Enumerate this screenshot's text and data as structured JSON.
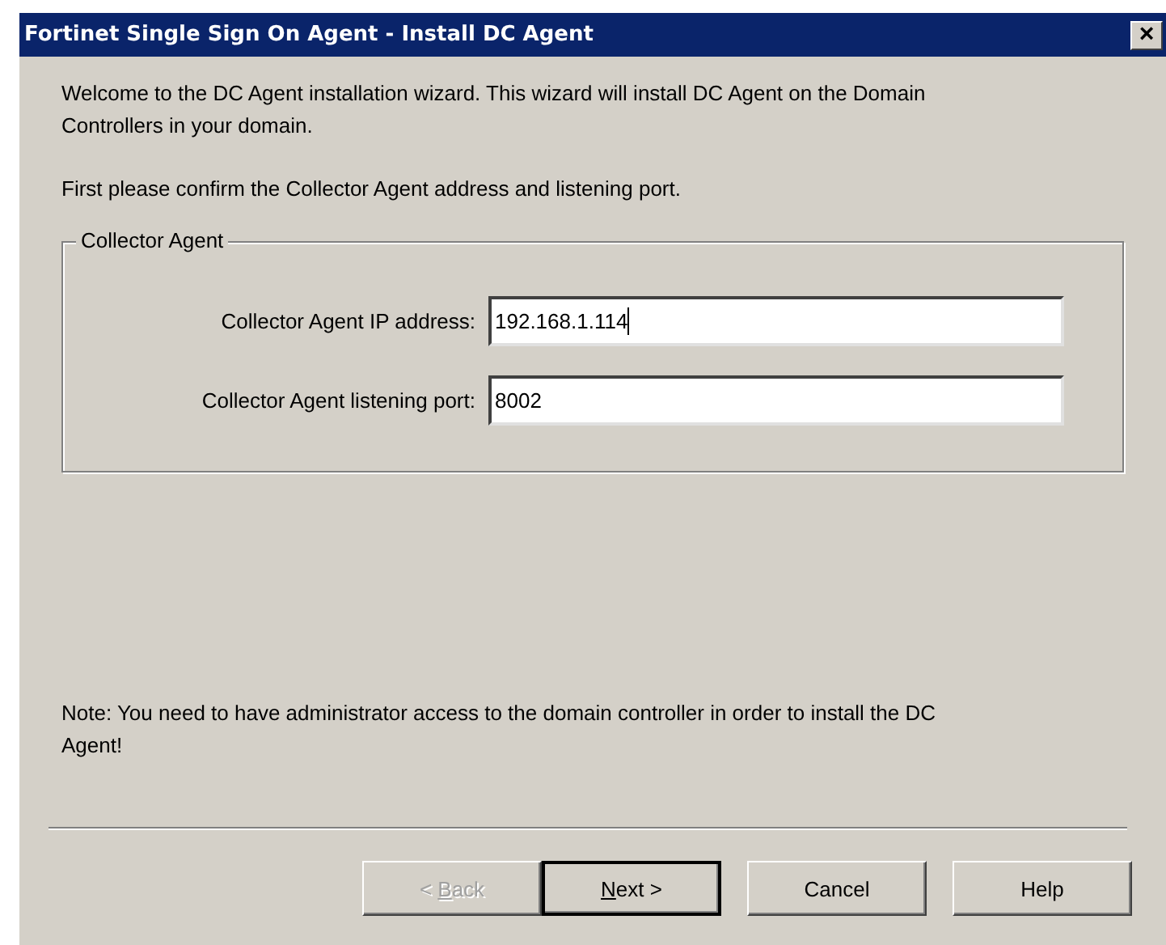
{
  "window": {
    "title": "Fortinet Single Sign On Agent - Install DC Agent",
    "close": "×"
  },
  "intro": "Welcome to the DC Agent installation wizard. This wizard will install DC Agent on the Domain Controllers in your domain.",
  "instruction": "First please confirm the Collector Agent address and listening port.",
  "group": {
    "title": "Collector Agent",
    "fields": [
      {
        "label": "Collector Agent IP address:",
        "value": "192.168.1.114",
        "focused": true
      },
      {
        "label": "Collector Agent listening port:",
        "value": "8002",
        "focused": false
      }
    ]
  },
  "note": "Note: You need to have administrator access to the domain controller in order to install the DC Agent!",
  "buttons": [
    {
      "label_parts": [
        {
          "text": "< ",
          "underlined": false
        },
        {
          "text": "B",
          "underlined": true
        },
        {
          "text": "ack",
          "underlined": false
        }
      ],
      "disabled": true,
      "default": false
    },
    {
      "label_parts": [
        {
          "text": "N",
          "underlined": true
        },
        {
          "text": "ext >",
          "underlined": false
        }
      ],
      "disabled": false,
      "default": true
    },
    {
      "label_parts": [
        {
          "text": "Cancel",
          "underlined": false
        }
      ],
      "disabled": false,
      "default": false
    },
    {
      "label_parts": [
        {
          "text": "Help",
          "underlined": false
        }
      ],
      "disabled": false,
      "default": false
    }
  ]
}
